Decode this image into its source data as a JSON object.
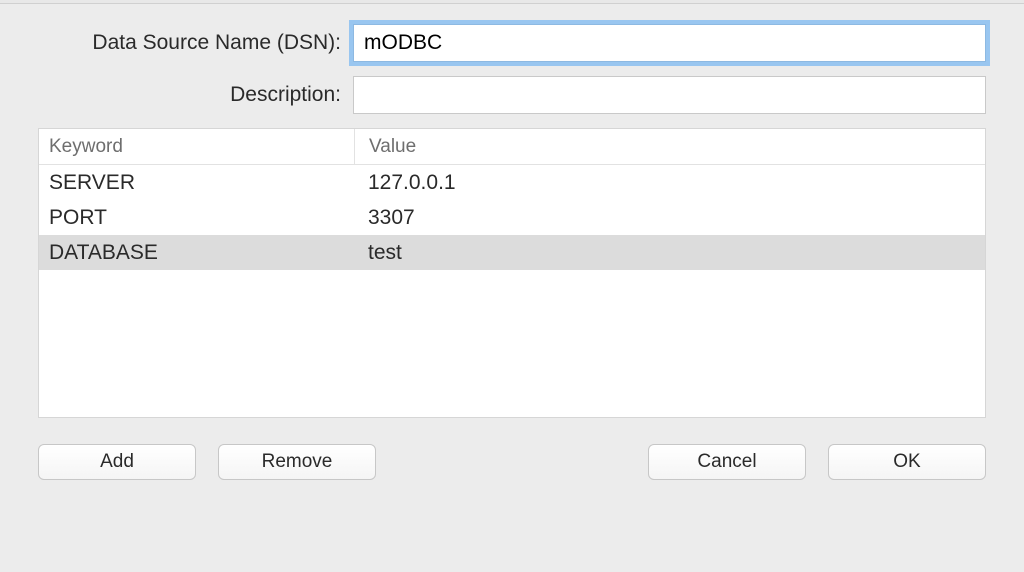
{
  "form": {
    "dsn_label": "Data Source Name (DSN):",
    "dsn_value": "mODBC",
    "description_label": "Description:",
    "description_value": ""
  },
  "table": {
    "headers": {
      "keyword": "Keyword",
      "value": "Value"
    },
    "rows": [
      {
        "keyword": "SERVER",
        "value": "127.0.0.1",
        "selected": false
      },
      {
        "keyword": "PORT",
        "value": "3307",
        "selected": false
      },
      {
        "keyword": "DATABASE",
        "value": "test",
        "selected": true
      }
    ]
  },
  "buttons": {
    "add": "Add",
    "remove": "Remove",
    "cancel": "Cancel",
    "ok": "OK"
  }
}
